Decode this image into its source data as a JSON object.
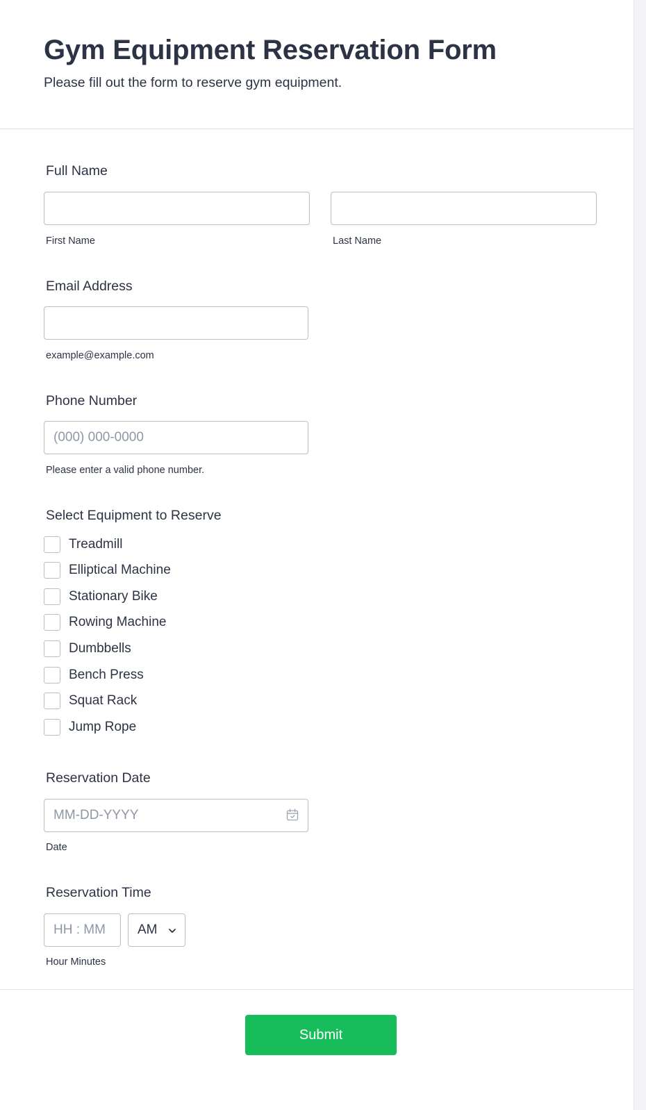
{
  "form": {
    "title": "Gym Equipment Reservation Form",
    "subtitle": "Please fill out the form to reserve gym equipment."
  },
  "full_name": {
    "label": "Full Name",
    "first_value": "",
    "last_value": "",
    "first_sublabel": "First Name",
    "last_sublabel": "Last Name"
  },
  "email": {
    "label": "Email Address",
    "value": "",
    "sublabel": "example@example.com"
  },
  "phone": {
    "label": "Phone Number",
    "placeholder": "(000) 000-0000",
    "sublabel": "Please enter a valid phone number."
  },
  "equipment": {
    "label": "Select Equipment to Reserve",
    "options": [
      {
        "label": "Treadmill",
        "checked": false
      },
      {
        "label": "Elliptical Machine",
        "checked": false
      },
      {
        "label": "Stationary Bike",
        "checked": false
      },
      {
        "label": "Rowing Machine",
        "checked": false
      },
      {
        "label": "Dumbbells",
        "checked": false
      },
      {
        "label": "Bench Press",
        "checked": false
      },
      {
        "label": "Squat Rack",
        "checked": false
      },
      {
        "label": "Jump Rope",
        "checked": false
      }
    ]
  },
  "reservation_date": {
    "label": "Reservation Date",
    "placeholder": "MM-DD-YYYY",
    "sublabel": "Date",
    "icon": "calendar-icon"
  },
  "reservation_time": {
    "label": "Reservation Time",
    "placeholder": "HH : MM",
    "ampm_value": "AM",
    "sublabel": "Hour Minutes",
    "icon": "chevron-down-icon"
  },
  "submit": {
    "label": "Submit",
    "color": "#18bd5b"
  }
}
